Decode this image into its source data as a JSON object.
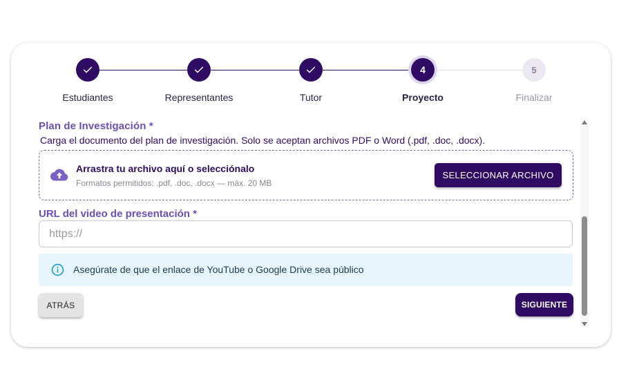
{
  "stepper": {
    "steps": [
      {
        "label": "Estudiantes",
        "state": "done",
        "number": "1"
      },
      {
        "label": "Representantes",
        "state": "done",
        "number": "2"
      },
      {
        "label": "Tutor",
        "state": "done",
        "number": "3"
      },
      {
        "label": "Proyecto",
        "state": "active",
        "number": "4"
      },
      {
        "label": "Finalizar",
        "state": "todo",
        "number": "5"
      }
    ],
    "done_icon": "check-icon"
  },
  "plan": {
    "title": "Plan de Investigación *",
    "description": "Carga el documento del plan de investigación. Solo se aceptan archivos PDF o Word (.pdf, .doc, .docx).",
    "dropzone_title": "Arrastra tu archivo aquí o selecciónalo",
    "dropzone_sub": "Formatos permitidos: .pdf, .doc, .docx — máx. 20 MB",
    "select_button": "SELECCIONAR ARCHIVO",
    "icon": "cloud-upload-icon"
  },
  "video": {
    "title": "URL del video de presentación *",
    "value": "",
    "placeholder": "https://"
  },
  "alert": {
    "text": "Asegúrate de que el enlace de YouTube o Google Drive sea público",
    "icon": "info-icon"
  },
  "nav": {
    "back": "ATRÁS",
    "next": "SIGUIENTE"
  },
  "colors": {
    "primary": "#2f0b63",
    "accent_text": "#6a4fb8",
    "alert_bg": "#e6f6fc",
    "info_icon": "#1f9fd6"
  }
}
